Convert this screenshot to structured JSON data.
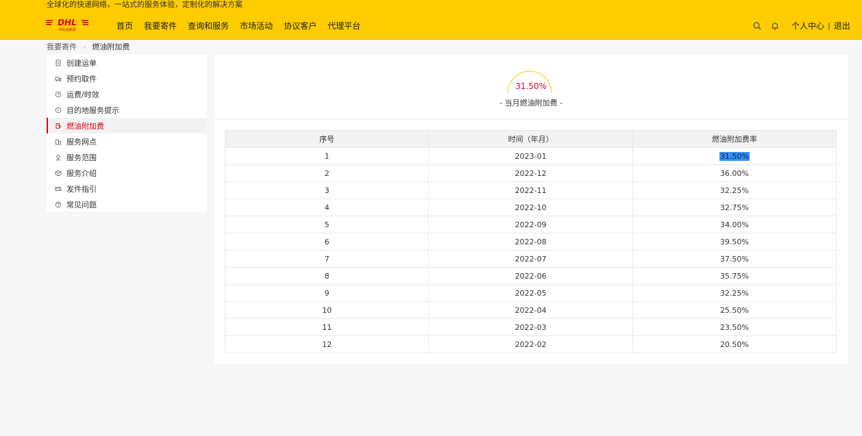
{
  "header": {
    "slogan": "全球化的快递网络，一站式的服务体验，定制化的解决方案",
    "logo_text": "DHL",
    "logo_sub": "中外运敦豪",
    "nav": [
      "首页",
      "我要寄件",
      "查询和服务",
      "市场活动",
      "协议客户",
      "代理平台"
    ],
    "user_center": "个人中心",
    "separator": "|",
    "logout": "退出"
  },
  "breadcrumb": [
    "我要寄件",
    "燃油附加费"
  ],
  "sidebar": {
    "items": [
      {
        "label": "创建运单",
        "icon": "document-icon"
      },
      {
        "label": "预约取件",
        "icon": "truck-icon"
      },
      {
        "label": "运费/时效",
        "icon": "clock-icon"
      },
      {
        "label": "目的地服务提示",
        "icon": "info-icon"
      },
      {
        "label": "燃油附加费",
        "icon": "fuel-icon",
        "active": true
      },
      {
        "label": "服务网点",
        "icon": "building-icon"
      },
      {
        "label": "服务范围",
        "icon": "location-icon"
      },
      {
        "label": "服务介绍",
        "icon": "box-icon"
      },
      {
        "label": "发件指引",
        "icon": "send-icon"
      },
      {
        "label": "常见问题",
        "icon": "question-icon"
      }
    ]
  },
  "gauge": {
    "value": "31.50%",
    "label": "- 当月燃油附加费 -",
    "color": "#ffcc00"
  },
  "table": {
    "headers": [
      "序号",
      "时间（年月）",
      "燃油附加费率"
    ],
    "rows": [
      [
        "1",
        "2023-01",
        "31.50%"
      ],
      [
        "2",
        "2022-12",
        "36.00%"
      ],
      [
        "3",
        "2022-11",
        "32.25%"
      ],
      [
        "4",
        "2022-10",
        "32.75%"
      ],
      [
        "5",
        "2022-09",
        "34.00%"
      ],
      [
        "6",
        "2022-08",
        "39.50%"
      ],
      [
        "7",
        "2022-07",
        "37.50%"
      ],
      [
        "8",
        "2022-06",
        "35.75%"
      ],
      [
        "9",
        "2022-05",
        "32.25%"
      ],
      [
        "10",
        "2022-04",
        "25.50%"
      ],
      [
        "11",
        "2022-03",
        "23.50%"
      ],
      [
        "12",
        "2022-02",
        "20.50%"
      ]
    ]
  },
  "colors": {
    "brand_yellow": "#ffcc00",
    "brand_red": "#d40511",
    "selection": "#3390ff"
  }
}
